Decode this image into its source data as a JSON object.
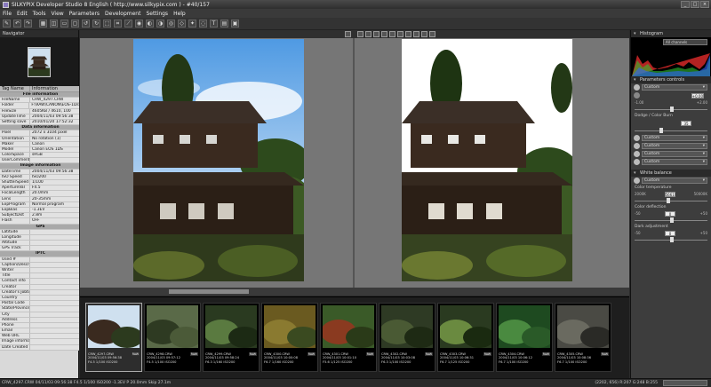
{
  "window": {
    "title": "SILKYPIX Developer Studio 8 English ( http://www.silkypix.com ) - #40/157",
    "buttons": [
      "_",
      "□",
      "×"
    ]
  },
  "menu": [
    "File",
    "Edit",
    "Tools",
    "View",
    "Parameters",
    "Development",
    "Settings",
    "Help"
  ],
  "toolbar_icons": [
    "pen",
    "undo",
    "redo",
    "grid",
    "split",
    "compare",
    "fit",
    "rotate-left",
    "rotate-right",
    "select",
    "crop",
    "straighten",
    "spot",
    "wb",
    "tone",
    "color",
    "sharpen",
    "noise",
    "lens",
    "text",
    "stack",
    "develop"
  ],
  "navigator": {
    "title": "Navigator"
  },
  "info": {
    "col_tag": "Tag Name",
    "col_info": "Information",
    "rows": [
      {
        "sec": "File information"
      },
      {
        "k": "FileName",
        "v": "CRW_4297.CRW"
      },
      {
        "k": "Folder",
        "v": "F:\\RAW\\CANON\\EOS-1Ds\\"
      },
      {
        "k": "FileSize",
        "v": "4605KB / 4610, 100"
      },
      {
        "k": "UpdateTime",
        "v": "2004/11/03 09:56:38"
      },
      {
        "k": "Setting save",
        "v": "2010/01/20 17:52:32"
      },
      {
        "sec": "Data information"
      },
      {
        "k": "Pixel",
        "v": "2072 x 3104 pixel"
      },
      {
        "k": "Orientation",
        "v": "No rotation (1)"
      },
      {
        "k": "Maker",
        "v": "Canon"
      },
      {
        "k": "Model",
        "v": "Canon EOS 1DS"
      },
      {
        "k": "ColorSpace",
        "v": "sRGB"
      },
      {
        "k": "UserComment",
        "v": ""
      },
      {
        "sec": "Image information"
      },
      {
        "k": "DateTime",
        "v": "2004/11/03 09:56:38"
      },
      {
        "k": "ISO Speed",
        "v": "ISO200"
      },
      {
        "k": "ShutterSpeed",
        "v": "1/100"
      },
      {
        "k": "ApertureVal",
        "v": "F4.5"
      },
      {
        "k": "FocalLength",
        "v": "20.0mm"
      },
      {
        "k": "Lens",
        "v": "20-35mm"
      },
      {
        "k": "ExpProgram",
        "v": "Normal program"
      },
      {
        "k": "ExpBias",
        "v": "-1.3EV"
      },
      {
        "k": "SubjectDist",
        "v": "2.8m"
      },
      {
        "k": "Flash",
        "v": "OFF"
      },
      {
        "sec": "GPS"
      },
      {
        "k": "Latitude",
        "v": ""
      },
      {
        "k": "Longitude",
        "v": ""
      },
      {
        "k": "Altitude",
        "v": ""
      },
      {
        "k": "GPS Track",
        "v": ""
      },
      {
        "sec": "IPTC"
      },
      {
        "k": "Used #",
        "v": ""
      },
      {
        "k": "Caption/Descri",
        "v": ""
      },
      {
        "k": "Writer",
        "v": ""
      },
      {
        "k": "Title",
        "v": ""
      },
      {
        "k": "Contact info",
        "v": ""
      },
      {
        "k": "Creator",
        "v": ""
      },
      {
        "k": "Creator's Jobtit",
        "v": ""
      },
      {
        "k": "Country",
        "v": ""
      },
      {
        "k": "Postal Code",
        "v": ""
      },
      {
        "k": "State/Province",
        "v": ""
      },
      {
        "k": "City",
        "v": ""
      },
      {
        "k": "Address",
        "v": ""
      },
      {
        "k": "Phone",
        "v": ""
      },
      {
        "k": "Email",
        "v": ""
      },
      {
        "k": "Web URL",
        "v": ""
      },
      {
        "k": "Image information",
        "v": ""
      },
      {
        "k": "Date Created",
        "v": ""
      }
    ]
  },
  "right": {
    "histogram_title": "Histogram",
    "histogram_channel": "All channels",
    "params_title": "Parameters controls",
    "custom1": "Custom",
    "exposure_value": "+0.00",
    "exp_min": "-1.00",
    "exp_max": "+2.00",
    "dodge_label": "Dodge / Color Burn",
    "dodge_value": "35",
    "custom2": "Custom",
    "custom3": "Custom",
    "custom4": "Custom",
    "custom5": "Custom",
    "wb_title": "White balance",
    "wb_custom": "Custom",
    "color_temp_label": "Color temperature",
    "color_temp_value": "5661",
    "ct_min": "2000K",
    "ct_max": "50000K",
    "color_def_label": "Color deflection",
    "color_def_value": "0",
    "cd_min": "-50",
    "cd_max": "+50",
    "dark_adj_label": "Dark adjustment",
    "dark_adj_value": "0",
    "da_min": "-50",
    "da_max": "+50"
  },
  "filmstrip": [
    {
      "name": "CRW_4297.CRW",
      "date": "2004/11/03 09:56:38",
      "exp": "F4.5 1/100 ISO200",
      "badge": "RAW"
    },
    {
      "name": "CRW_4298.CRW",
      "date": "2004/11/03 09:57:12",
      "exp": "F4.5 1/100 ISO200",
      "badge": "RAW"
    },
    {
      "name": "CRW_4299.CRW",
      "date": "2004/11/03 09:58:24",
      "exp": "F6.3 1/160 ISO200",
      "badge": "RAW"
    },
    {
      "name": "CRW_4300.CRW",
      "date": "2004/11/03 10:00:08",
      "exp": "F6.7 1/160 ISO200",
      "badge": "RAW"
    },
    {
      "name": "CRW_4301.CRW",
      "date": "2004/11/03 10:01:10",
      "exp": "F5.6 1/125 ISO200",
      "badge": "RAW"
    },
    {
      "name": "CRW_4302.CRW",
      "date": "2004/11/03 10:03:08",
      "exp": "F6.3 1/100 ISO200",
      "badge": "RAW"
    },
    {
      "name": "CRW_4303.CRW",
      "date": "2004/11/03 10:06:31",
      "exp": "F6.7 1/125 ISO200",
      "badge": "RAW"
    },
    {
      "name": "CRW_4304.CRW",
      "date": "2004/11/03 10:06:12",
      "exp": "F6.7 1/100 ISO200",
      "badge": "RAW"
    },
    {
      "name": "CRW_4305.CRW",
      "date": "2004/11/03 10:08:36",
      "exp": "F6.7 1/100 ISO200",
      "badge": "RAW"
    }
  ],
  "status": {
    "left": "CRW_4297.CRW 04/11/03 09:56:38 F4.5 1/100 ISO200 -1.3EV P 20.0mm Skip 27.1m",
    "right": "(2202, 656) R:207 G:248 B:255"
  },
  "colors": {
    "accent": "#2e2e2e",
    "panel": "#3d3d3d",
    "info_bg": "#e2e2e2"
  }
}
